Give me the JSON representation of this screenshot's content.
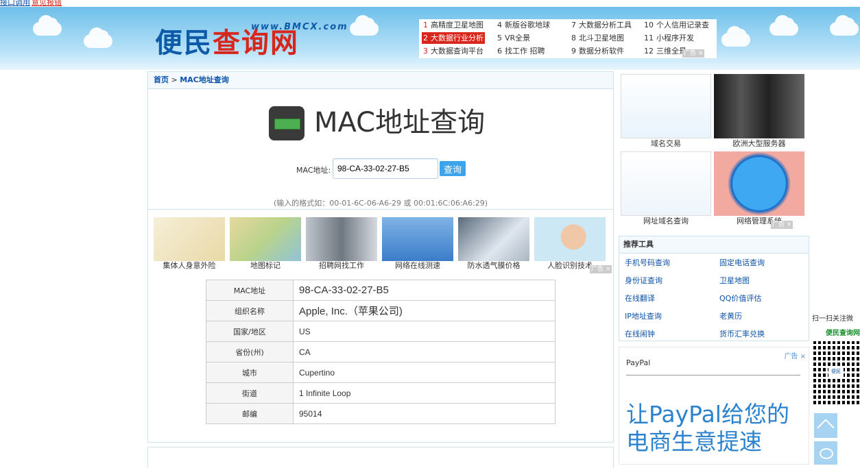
{
  "topbar": {
    "link1": "接口调用",
    "link2": "意见报错"
  },
  "logo": {
    "url": "www.BMCX.com",
    "text_blue": "便民",
    "text_red": "查询网"
  },
  "toplinks": [
    {
      "n": "1",
      "label": "高精度卫星地图"
    },
    {
      "n": "2",
      "label": "大数据行业分析"
    },
    {
      "n": "3",
      "label": "大数据查询平台"
    },
    {
      "n": "4",
      "label": "新版谷歌地球"
    },
    {
      "n": "5",
      "label": "VR全景"
    },
    {
      "n": "6",
      "label": "找工作 招聘"
    },
    {
      "n": "7",
      "label": "大数据分析工具"
    },
    {
      "n": "8",
      "label": "北斗卫星地图"
    },
    {
      "n": "9",
      "label": "数据分析软件"
    },
    {
      "n": "10",
      "label": "个人信用记录查"
    },
    {
      "n": "11",
      "label": "小程序开发"
    },
    {
      "n": "12",
      "label": "三维全景"
    }
  ],
  "ad_label": "广告",
  "ad_close": "×",
  "breadcrumb": {
    "home": "首页",
    "sep": " > ",
    "current": "MAC地址查询"
  },
  "page_title": "MAC地址查询",
  "form": {
    "label": "MAC地址:",
    "value": "98-CA-33-02-27-B5",
    "button": "查询",
    "hint": "(输入的格式如：00-01-6C-06-A6-29 或 00:01:6C:06:A6:29)"
  },
  "thumbs": [
    {
      "caption": "集体人身意外险"
    },
    {
      "caption": "地图标记"
    },
    {
      "caption": "招聘网找工作"
    },
    {
      "caption": "网络在线测速"
    },
    {
      "caption": "防水透气膜价格"
    },
    {
      "caption": "人脸识别技术"
    }
  ],
  "result": [
    {
      "key": "MAC地址",
      "value": "98-CA-33-02-27-B5"
    },
    {
      "key": "组织名称",
      "value": "Apple, Inc.（苹果公司)"
    },
    {
      "key": "国家/地区",
      "value": "US"
    },
    {
      "key": "省份(州)",
      "value": "CA"
    },
    {
      "key": "城市",
      "value": "Cupertino"
    },
    {
      "key": "街道",
      "value": "1 Infinite Loop"
    },
    {
      "key": "邮编",
      "value": "95014"
    }
  ],
  "side_ads": [
    {
      "caption": "域名交易"
    },
    {
      "caption": "欧洲大型服务器"
    },
    {
      "caption": "网址域名查询"
    },
    {
      "caption": "网络管理系统"
    }
  ],
  "tools": {
    "title": "推荐工具",
    "links": [
      "手机号码查询",
      "固定电话查询",
      "身份证查询",
      "卫星地图",
      "在线翻译",
      "QQ价值评估",
      "IP地址查询",
      "老黄历",
      "在线闹钟",
      "货币汇率兑换"
    ]
  },
  "paypal_ad": {
    "brand": "PayPal",
    "slogan": "让PayPal给您的电商生意提速",
    "label": "广告 ×"
  },
  "qr": {
    "line1": "扫一扫关注微",
    "line2": "便民查询网",
    "logo": "便民"
  }
}
